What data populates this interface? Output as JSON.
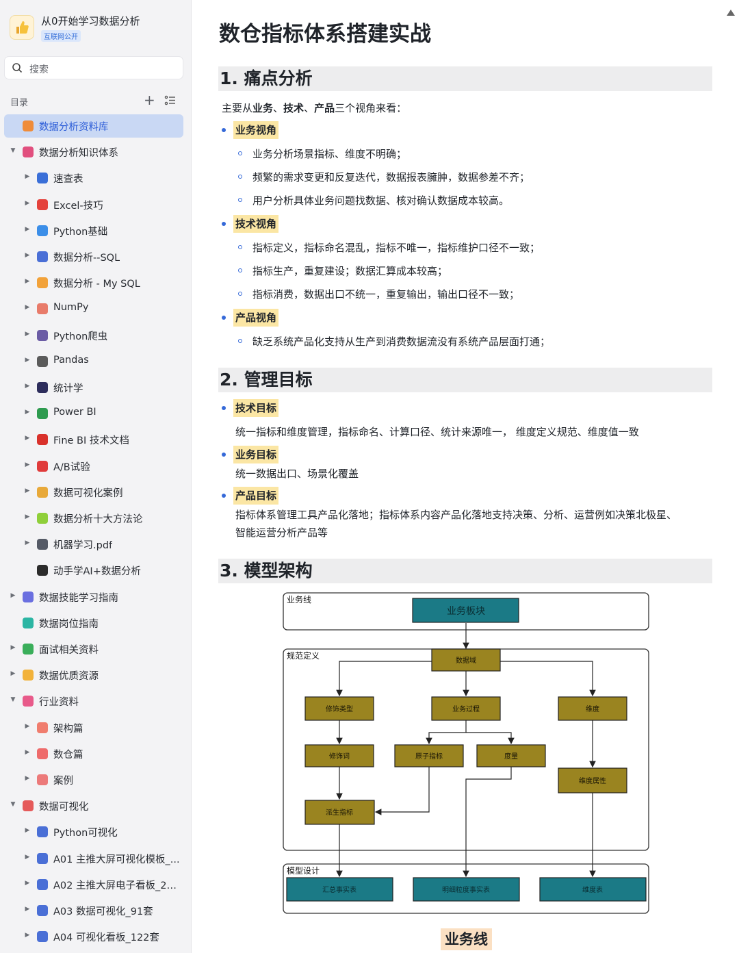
{
  "knowledge_base": {
    "title": "从0开始学习数据分析",
    "badge": "互联网公开"
  },
  "search": {
    "placeholder": "搜索"
  },
  "toc": {
    "label": "目录"
  },
  "sidebar": {
    "items": [
      {
        "label": "数据分析资料库",
        "level": 0,
        "caret": "",
        "icon": "database-icon",
        "color": "#ef8c3a",
        "active": true
      },
      {
        "label": "数据分析知识体系",
        "level": 0,
        "caret": "down",
        "icon": "book-icon",
        "color": "#e14f7e"
      },
      {
        "label": "速查表",
        "level": 1,
        "caret": "right",
        "icon": "magnifier-icon",
        "color": "#3a6fd8"
      },
      {
        "label": "Excel-技巧",
        "level": 1,
        "caret": "right",
        "icon": "hundred-icon",
        "color": "#e4423c"
      },
      {
        "label": "Python基础",
        "level": 1,
        "caret": "right",
        "icon": "laptop-icon",
        "color": "#3b8ee8"
      },
      {
        "label": "数据分析--SQL",
        "level": 1,
        "caret": "right",
        "icon": "bar-chart-icon",
        "color": "#4a6fd6"
      },
      {
        "label": "数据分析 - My SQL",
        "level": 1,
        "caret": "right",
        "icon": "rainbow-icon",
        "color": "#f2a23a"
      },
      {
        "label": "NumPy",
        "level": 1,
        "caret": "right",
        "icon": "memo-icon",
        "color": "#e87b6a"
      },
      {
        "label": "Python爬虫",
        "level": 1,
        "caret": "right",
        "icon": "spider-icon",
        "color": "#6b5ca5"
      },
      {
        "label": "Pandas",
        "level": 1,
        "caret": "right",
        "icon": "panda-icon",
        "color": "#5b5b5b"
      },
      {
        "label": "统计学",
        "level": 1,
        "caret": "right",
        "icon": "floppy-icon",
        "color": "#2d2d5c"
      },
      {
        "label": "Power BI",
        "level": 1,
        "caret": "right",
        "icon": "recycle-icon",
        "color": "#2e9b4f"
      },
      {
        "label": "Fine BI 技术文档",
        "level": 1,
        "caret": "right",
        "icon": "pin-icon",
        "color": "#d9312b"
      },
      {
        "label": "A/B试验",
        "level": 1,
        "caret": "right",
        "icon": "ab-icon",
        "color": "#e03b3b"
      },
      {
        "label": "数据可视化案例",
        "level": 1,
        "caret": "right",
        "icon": "medal-icon",
        "color": "#e8a93a"
      },
      {
        "label": "数据分析十大方法论",
        "level": 1,
        "caret": "right",
        "icon": "puzzle-icon",
        "color": "#8fcf3a"
      },
      {
        "label": "机器学习.pdf",
        "level": 1,
        "caret": "right",
        "icon": "robot-icon",
        "color": "#555a66"
      },
      {
        "label": "动手学AI+数据分析",
        "level": 1,
        "caret": "",
        "icon": "traffic-light-icon",
        "color": "#2b2b2b"
      },
      {
        "label": "数据技能学习指南",
        "level": 0,
        "caret": "right",
        "icon": "guide-icon",
        "color": "#6a6fe0"
      },
      {
        "label": "数据岗位指南",
        "level": 0,
        "caret": "",
        "icon": "compass-icon",
        "color": "#2bb5a3"
      },
      {
        "label": "面试相关资料",
        "level": 0,
        "caret": "right",
        "icon": "clock-icon",
        "color": "#3aae5a"
      },
      {
        "label": "数据优质资源",
        "level": 0,
        "caret": "right",
        "icon": "thumbs-up-icon",
        "color": "#f2b23a"
      },
      {
        "label": "行业资料",
        "level": 0,
        "caret": "down",
        "icon": "heart-card-icon",
        "color": "#e85a8a"
      },
      {
        "label": "架构篇",
        "level": 1,
        "caret": "right",
        "icon": "layers-icon",
        "color": "#f07d6e"
      },
      {
        "label": "数仓篇",
        "level": 1,
        "caret": "right",
        "icon": "warehouse-icon",
        "color": "#ee6b6b"
      },
      {
        "label": "案例",
        "level": 1,
        "caret": "right",
        "icon": "case-icon",
        "color": "#ec7a7a"
      },
      {
        "label": "数据可视化",
        "level": 0,
        "caret": "down",
        "icon": "rocket-icon",
        "color": "#e55a5a"
      },
      {
        "label": "Python可视化",
        "level": 1,
        "caret": "right",
        "icon": "bar-chart-icon",
        "color": "#4a6fd6"
      },
      {
        "label": "A01 主推大屏可视化模板_...",
        "level": 1,
        "caret": "right",
        "icon": "bar-chart-icon",
        "color": "#4a6fd6"
      },
      {
        "label": "A02 主推大屏电子看板_20套",
        "level": 1,
        "caret": "right",
        "icon": "bar-chart-icon",
        "color": "#4a6fd6"
      },
      {
        "label": "A03 数据可视化_91套",
        "level": 1,
        "caret": "right",
        "icon": "bar-chart-icon",
        "color": "#4a6fd6"
      },
      {
        "label": "A04 可视化看板_122套",
        "level": 1,
        "caret": "right",
        "icon": "bar-chart-icon",
        "color": "#4a6fd6"
      }
    ]
  },
  "doc": {
    "title": "数仓指标体系搭建实战",
    "s1": {
      "heading": "1. 痛点分析",
      "intro_pre": "主要从",
      "intro_b1": "业务",
      "intro_sep1": "、",
      "intro_b2": "技术",
      "intro_sep2": "、",
      "intro_b3": "产品",
      "intro_post": "三个视角来看：",
      "g1_label": "业务视角",
      "g1_items": [
        "业务分析场景指标、维度不明确；",
        "频繁的需求变更和反复迭代，数据报表臃肿，数据参差不齐；",
        "用户分析具体业务问题找数据、核对确认数据成本较高。"
      ],
      "g2_label": "技术视角",
      "g2_items": [
        "指标定义，指标命名混乱，指标不唯一，指标维护口径不一致；",
        "指标生产，重复建设；数据汇算成本较高；",
        "指标消费，数据出口不统一，重复输出，输出口径不一致；"
      ],
      "g3_label": "产品视角",
      "g3_items": [
        "缺乏系统产品化支持从生产到消费数据流没有系统产品层面打通；"
      ]
    },
    "s2": {
      "heading": "2. 管理目标",
      "t1_label": "技术目标",
      "t1_text": "统一指标和维度管理，指标命名、计算口径、统计来源唯一， 维度定义规范、维度值一致",
      "t2_label": "业务目标",
      "t2_text": "统一数据出口、场景化覆盖",
      "t3_label": "产品目标",
      "t3_text1": "指标体系管理工具产品化落地；指标体系内容产品化落地支持决策、分析、运营例如决策北极星、",
      "t3_text2": "智能运营分析产品等"
    },
    "s3": {
      "heading": "3. 模型架构",
      "diagram": {
        "group_business": "业务线",
        "group_spec": "规范定义",
        "group_model": "模型设计",
        "node_business_block": "业务板块",
        "node_data_domain": "数据域",
        "node_modifier_type": "修饰类型",
        "node_business_process": "业务过程",
        "node_dimension": "维度",
        "node_modifier": "修饰词",
        "node_atomic_metric": "原子指标",
        "node_measure": "度量",
        "node_dimension_attr": "维度属性",
        "node_derived_metric": "派生指标",
        "node_summary_fact": "汇总事实表",
        "node_detail_fact": "明细粒度事实表",
        "node_dim_table": "维度表"
      },
      "bottom_label": "业务线"
    }
  },
  "colors": {
    "accent": "#3569d8",
    "highlight": "#fbe6a4",
    "heading_bg": "#ededee",
    "teal_node": "#1b7a86",
    "olive_node": "#9a8420"
  }
}
